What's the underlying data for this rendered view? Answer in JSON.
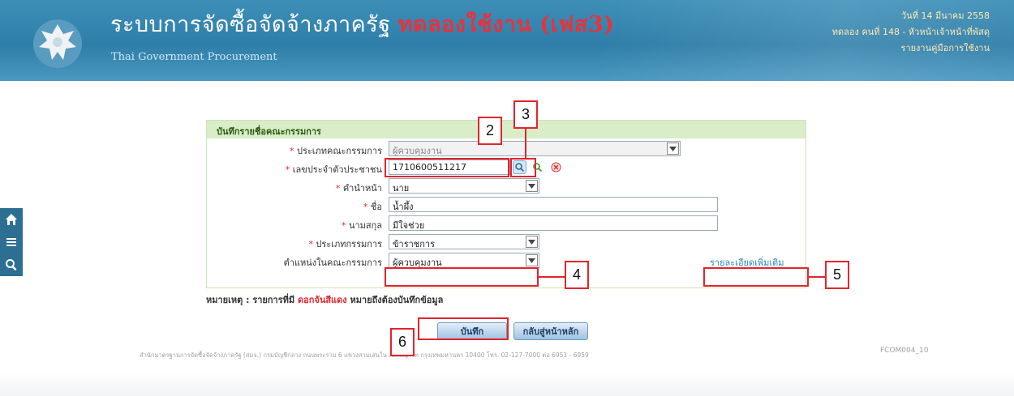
{
  "header": {
    "title_main": "ระบบการจัดซื้อจัดจ้างภาครัฐ",
    "title_trial": "ทดลองใช้งาน (เฟส3)",
    "subtitle": "Thai Government Procurement",
    "date": "วันที่ 14 มีนาคม 2558",
    "user": "ทดลอง คนที่ 148 - หัวหน้าเจ้าหน้าที่พัสดุ",
    "manual": "รายงานคู่มือการใช้งาน"
  },
  "sidebar": {
    "home_icon": "home-icon",
    "menu_icon": "menu-icon",
    "search_icon": "search-icon"
  },
  "form": {
    "title": "บันทึกรายชื่อคณะกรรมการ",
    "committee_type": {
      "label": "ประเภทคณะกรรมการ",
      "value": "ผู้ควบคุมงาน"
    },
    "citizen_id": {
      "label": "เลขประจำตัวประชาชน",
      "value": "1710600511217"
    },
    "prefix": {
      "label": "คำนำหน้า",
      "value": "นาย"
    },
    "first_name": {
      "label": "ชื่อ",
      "value": "น้ำผึ้ง"
    },
    "last_name": {
      "label": "นามสกุล",
      "value": "มีใจช่วย"
    },
    "member_type": {
      "label": "ประเภทกรรมการ",
      "value": "ข้าราชการ"
    },
    "position": {
      "label": "ตำแหน่งในคณะกรรมการ",
      "value": "ผู้ควบคุมงาน"
    },
    "extra_link": "รายละเอียดเพิ่มเติม"
  },
  "note": {
    "prefix": "หมายเหตุ : รายการที่มี",
    "red": "ดอกจันสีแดง",
    "suffix": "หมายถึงต้องบันทึกข้อมูล"
  },
  "buttons": {
    "save": "บันทึก",
    "back": "กลับสู่หน้าหลัก"
  },
  "footer": {
    "text": "สำนักมาตรฐานการจัดซื้อจัดจ้างภาครัฐ (สมจ.) กรมบัญชีกลาง ถนนพระราม 6 แขวงสามเสนใน เขตพญาไท กรุงเทพมหานคร 10400 โทร. 02-127-7000 ต่อ 6951 - 6959",
    "page_code": "FCOM004_10"
  },
  "annotations": [
    "2",
    "3",
    "4",
    "5",
    "6"
  ],
  "colors": {
    "header": "#2e7ea9",
    "accent_red": "#e3242b",
    "form_title_bg": "#d8edc8",
    "link": "#2a86c8"
  }
}
